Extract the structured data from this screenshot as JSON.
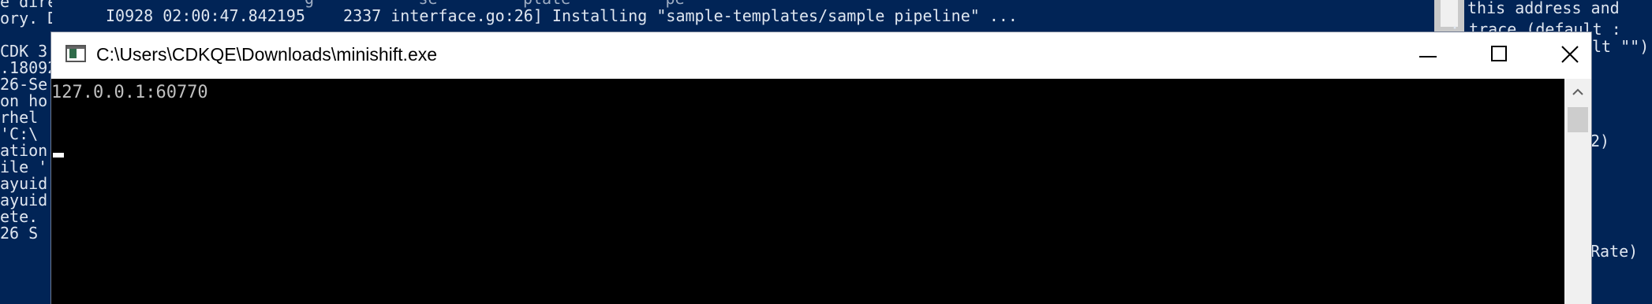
{
  "background_left": {
    "lines": [
      "e director",
      "ory. Do yo",
      "",
      "CDK 3",
      ".18092",
      "26-Se",
      "on ho",
      "rhel",
      "'C:\\",
      "ation",
      "ile '",
      "ayuid",
      "ayuid",
      "ete.",
      "26 S"
    ]
  },
  "background_top": {
    "log_line": "I0928 02:00:47.842195    2337 interface.go:26] Installing \"sample-templates/sample pipeline\" ...",
    "ghost_line": "g           se         plate          pe"
  },
  "background_right": {
    "lines": [
      "this address and",
      ": trace (default :",
      "lt \"\")",
      "2)",
      "Rate)"
    ]
  },
  "window": {
    "title": "C:\\Users\\CDKQE\\Downloads\\minishift.exe",
    "console_text": "127.0.0.1:60770",
    "icon": "console-app-icon",
    "buttons": {
      "minimize": "minimize-icon",
      "maximize": "maximize-icon",
      "close": "close-icon"
    }
  },
  "colors": {
    "powershell_bg": "#012456",
    "console_bg": "#000000",
    "console_fg": "#c0c0c0"
  }
}
